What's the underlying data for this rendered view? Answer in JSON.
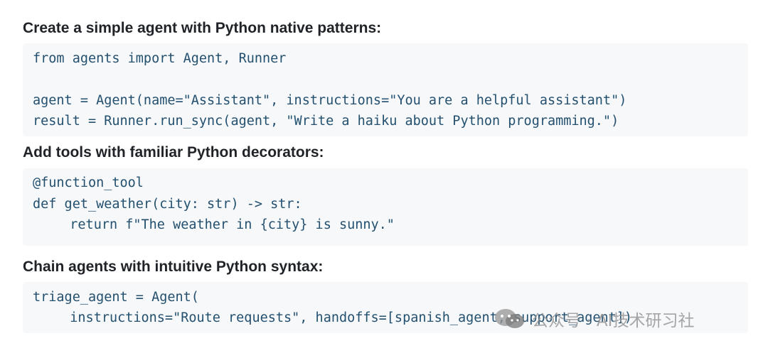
{
  "sections": [
    {
      "heading": "Create a simple agent with Python native patterns:",
      "code": [
        "from agents import Agent, Runner",
        "",
        "agent = Agent(name=\"Assistant\", instructions=\"You are a helpful assistant\")",
        "result = Runner.run_sync(agent, \"Write a haiku about Python programming.\")"
      ]
    },
    {
      "heading": "Add tools with familiar Python decorators:",
      "code": [
        "@function_tool",
        "def get_weather(city: str) -> str:",
        "  return f\"The weather in {city} is sunny.\""
      ]
    },
    {
      "heading": "Chain agents with intuitive Python syntax:",
      "code": [
        "triage_agent = Agent(",
        "  instructions=\"Route requests\", handoffs=[spanish_agent, support_agent])"
      ]
    }
  ],
  "watermark": {
    "icon": "wechat-icon",
    "text": "公众号 · AI技术研习社"
  },
  "colors": {
    "code_background": "#f6f8fa",
    "code_text": "#24506f",
    "heading_text": "#1f2328"
  }
}
